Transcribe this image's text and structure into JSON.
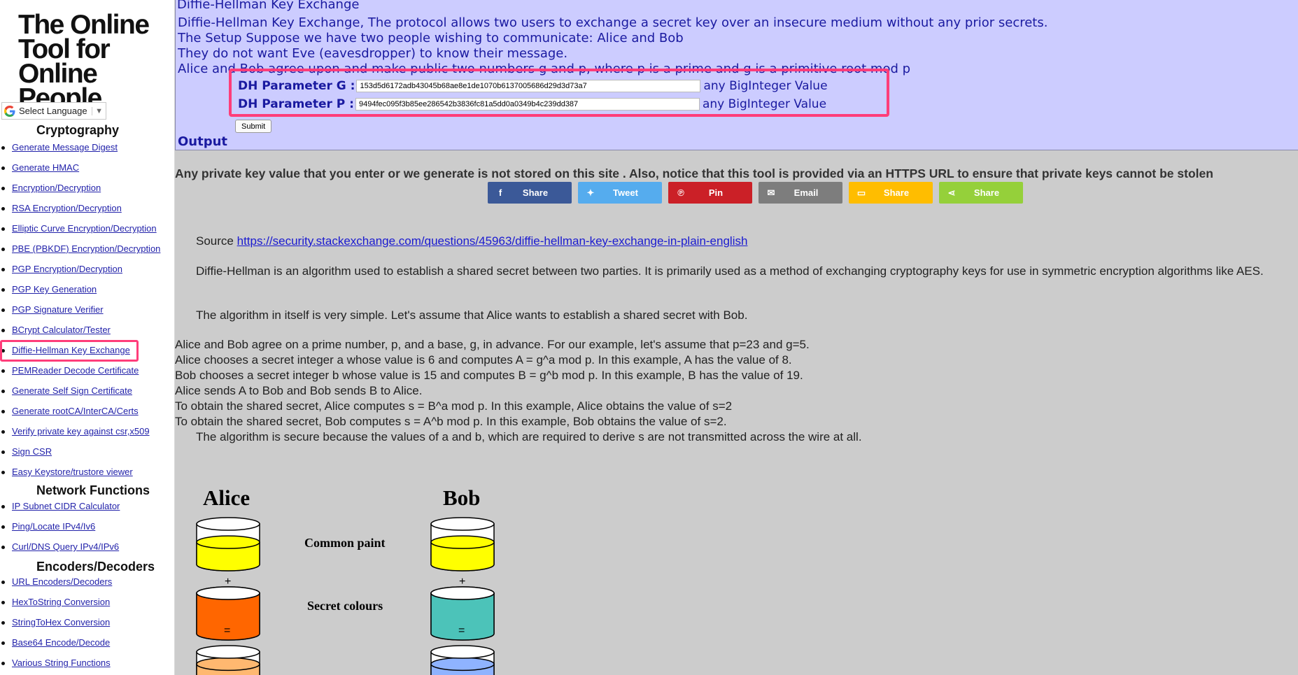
{
  "logo": {
    "text": "The Online Tool for Online People"
  },
  "language": {
    "label": "Select Language",
    "arrow": "▼"
  },
  "sidebar": {
    "sections": [
      {
        "heading": "Cryptography",
        "items": [
          "Generate Message Digest",
          "Generate HMAC",
          "Encryption/Decryption",
          "RSA Encryption/Decryption",
          "Elliptic Curve Encryption/Decryption",
          "PBE (PBKDF) Encryption/Decryption",
          "PGP Encryption/Decryption",
          "PGP Key Generation",
          "PGP Signature Verifier",
          "BCrypt Calculator/Tester",
          "Diffie-Hellman Key Exchange",
          "PEMReader Decode Certificate",
          "Generate Self Sign Certificate",
          "Generate rootCA/InterCA/Certs",
          "Verify private key against csr,x509",
          "Sign CSR",
          "Easy Keystore/trustore viewer"
        ]
      },
      {
        "heading": "Network Functions",
        "items": [
          "IP Subnet CIDR Calculator",
          "Ping/Locate IPv4/Iv6",
          "Curl/DNS Query IPv4/IPv6"
        ]
      },
      {
        "heading": "Encoders/Decoders",
        "items": [
          "URL Encoders/Decoders",
          "HexToString Conversion",
          "StringToHex Conversion",
          "Base64 Encode/Decode",
          "Various String Functions"
        ]
      }
    ],
    "active_item": "Diffie-Hellman Key Exchange",
    "highlight_color": "#ff3d7a"
  },
  "form": {
    "legend": "Diffie-Hellman Key Exchange",
    "intro_lines": [
      "Diffie-Hellman Key Exchange, The protocol allows two users to exchange a secret key over an insecure medium without any prior secrets.",
      "The Setup Suppose we have two people wishing to communicate: Alice and Bob",
      "They do not want Eve (eavesdropper) to know their message.",
      "Alice and Bob agree upon and make public two numbers g and p, where p is a prime and g is a primitive root mod p"
    ],
    "param_g": {
      "label": "DH Parameter G :",
      "value": "153d5d6172adb43045b68ae8e1de1070b6137005686d29d3d73a7",
      "hint": "any BigInteger Value"
    },
    "param_p": {
      "label": "DH Parameter P :",
      "value": "9494fec095f3b85ee286542b3836fc81a5dd0a0349b4c239dd387",
      "hint": "any BigInteger Value"
    },
    "submit_label": "Submit",
    "output_label": "Output",
    "panel_color": "#ccccff"
  },
  "notice": "Any private key value that you enter or we generate is not stored on this site . Also, notice that this tool is provided via an HTTPS URL to ensure that private keys cannot be stolen",
  "share": [
    {
      "icon": "facebook-icon",
      "glyph": "f",
      "label": "Share",
      "color": "#3b5998"
    },
    {
      "icon": "twitter-icon",
      "glyph": "✦",
      "label": "Tweet",
      "color": "#55acee"
    },
    {
      "icon": "pinterest-icon",
      "glyph": "℗",
      "label": "Pin",
      "color": "#cb2027"
    },
    {
      "icon": "email-icon",
      "glyph": "✉",
      "label": "Email",
      "color": "#7d7d7d"
    },
    {
      "icon": "sms-icon",
      "glyph": "▭",
      "label": "Share",
      "color": "#ffbd00"
    },
    {
      "icon": "share-icon",
      "glyph": "⋖",
      "label": "Share",
      "color": "#95d03a"
    }
  ],
  "article": {
    "source_prefix": "Source",
    "source_link": "https://security.stackexchange.com/questions/45963/diffie-hellman-key-exchange-in-plain-english",
    "para1": "Diffie-Hellman is an algorithm used to establish a shared secret between two parties. It is primarily used as a method of exchanging cryptography keys for use in symmetric encryption algorithms like AES.",
    "para2": "The algorithm in itself is very simple. Let's assume that Alice wants to establish a shared secret with Bob.",
    "steps": [
      "Alice and Bob agree on a prime number, p, and a base, g, in advance. For our example, let's assume that p=23 and g=5.",
      "Alice chooses a secret integer a whose value is 6 and computes A = g^a mod p. In this example, A has the value of 8.",
      "Bob chooses a secret integer b whose value is 15 and computes B = g^b mod p. In this example, B has the value of 19.",
      "Alice sends A to Bob and Bob sends B to Alice.",
      "To obtain the shared secret, Alice computes s = B^a mod p. In this example, Alice obtains the value of s=2",
      "To obtain the shared secret, Bob computes s = A^b mod p. In this example, Bob obtains the value of s=2."
    ],
    "conclusion": "The algorithm is secure because the values of a and b, which are required to derive s are not transmitted across the wire at all."
  },
  "diagram": {
    "alice": "Alice",
    "bob": "Bob",
    "common_paint": "Common paint",
    "secret_colours": "Secret colours",
    "plus": "+",
    "equals": "=",
    "colors": {
      "common": "#ffff00",
      "alice_secret": "#ff6600",
      "bob_secret": "#4cc3b9",
      "alice_mix": "#ffb870",
      "bob_mix": "#8fb3ff"
    }
  }
}
